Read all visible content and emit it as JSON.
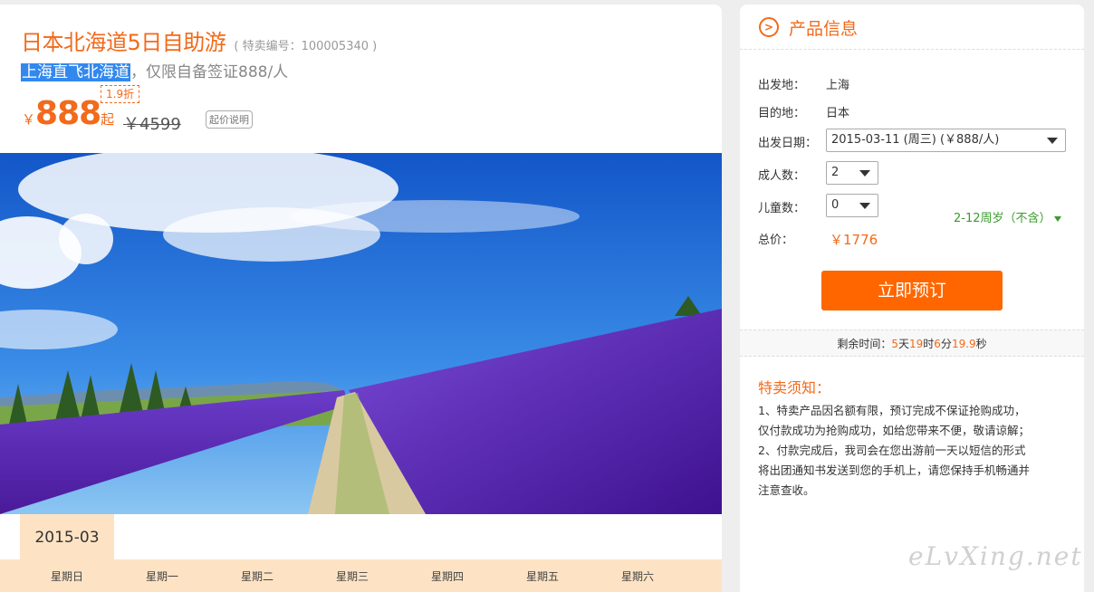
{
  "product": {
    "title": "日本北海道5日自助游",
    "product_no": "( 特卖编号：100005340 )",
    "subtitle_highlight": "上海直飞北海道",
    "subtitle_rest": "，仅限自备签证888/人",
    "discount": "1.9折",
    "currency": "￥",
    "price": "888",
    "price_suffix": "起",
    "original_price": "￥4599",
    "price_note": "起价说明"
  },
  "calendar": {
    "month": "2015-03",
    "weekdays": [
      "星期日",
      "星期一",
      "星期二",
      "星期三",
      "星期四",
      "星期五",
      "星期六"
    ]
  },
  "info": {
    "title": "产品信息",
    "departure_label": "出发地：",
    "departure_value": "上海",
    "destination_label": "目的地：",
    "destination_value": "日本",
    "date_label": "出发日期：",
    "date_value": "2015-03-11 (周三) (￥888/人)",
    "adults_label": "成人数：",
    "adults_value": "2",
    "children_label": "儿童数：",
    "children_value": "0",
    "age_note": "2-12周岁（不含）",
    "total_label": "总价：",
    "total_value": "￥1776",
    "book_button": "立即预订"
  },
  "timer": {
    "label": "剩余时间：",
    "days": "5",
    "days_unit": "天",
    "hours": "19",
    "hours_unit": "时",
    "minutes": "6",
    "minutes_unit": "分",
    "seconds": "19.9",
    "seconds_unit": "秒"
  },
  "notice": {
    "title": "特卖须知：",
    "lines": [
      "1、特卖产品因名额有限，预订完成不保证抢购成功，",
      "仅付款成功为抢购成功，如给您带来不便，敬请谅解；",
      "2、付款完成后，我司会在您出游前一天以短信的形式",
      "将出团通知书发送到您的手机上，请您保持手机畅通并",
      "注意查收。"
    ]
  },
  "watermark": "eLvXing.net",
  "colors": {
    "accent": "#f26a1b",
    "button": "#ff6600",
    "calendar_bg": "#fde3c4",
    "green": "#3a9a2c"
  }
}
